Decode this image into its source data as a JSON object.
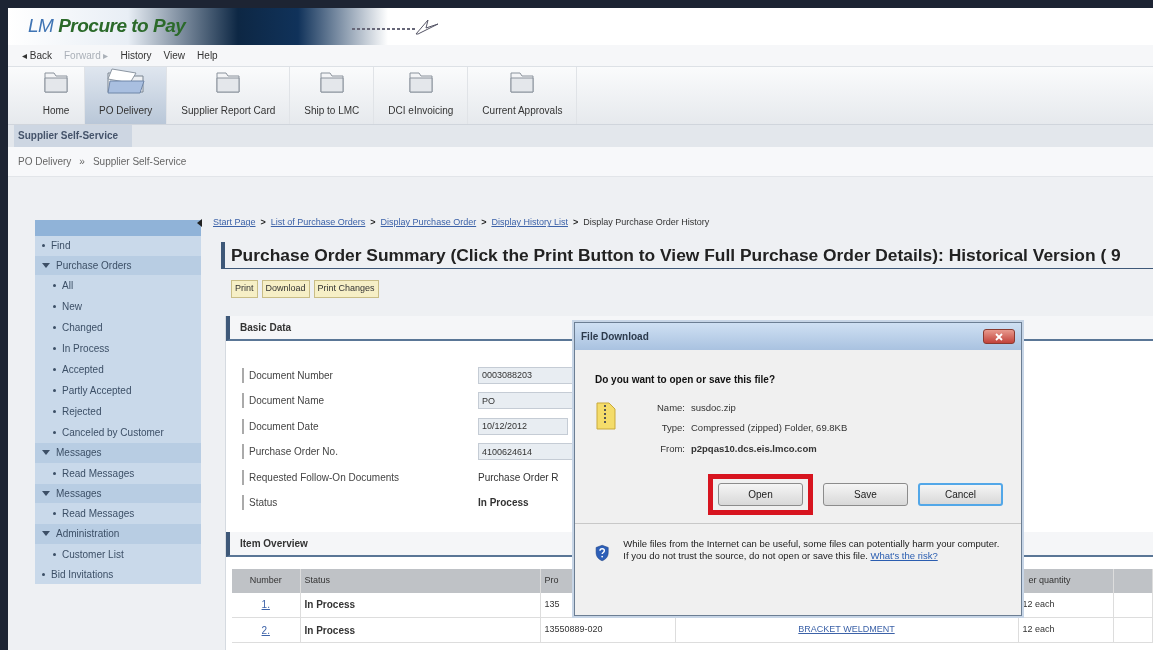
{
  "app": {
    "logo": "LM **Procure to Pay**"
  },
  "menu": [
    {
      "label": "◂ Back",
      "disabled": false
    },
    {
      "label": "Forward ▸",
      "disabled": true
    },
    {
      "label": "History",
      "disabled": false
    },
    {
      "label": "View",
      "disabled": false
    },
    {
      "label": "Help",
      "disabled": false
    }
  ],
  "toolbar": [
    {
      "label": "Home",
      "selected": false
    },
    {
      "label": "PO Delivery",
      "selected": true
    },
    {
      "label": "Supplier Report Card",
      "selected": false
    },
    {
      "label": "Ship to LMC",
      "selected": false
    },
    {
      "label": "DCI eInvoicing",
      "selected": false
    },
    {
      "label": "Current Approvals",
      "selected": false
    }
  ],
  "tabs": [
    {
      "label": "Supplier Self-Service",
      "selected": true
    }
  ],
  "location": [
    {
      "label": "PO Delivery"
    },
    {
      "separator": "»",
      "label": "Supplier Self-Service"
    }
  ],
  "sidebar": {
    "items": [
      {
        "label": "Find"
      },
      {
        "label": "Purchase Orders",
        "expanded": true,
        "children": [
          {
            "label": "All"
          },
          {
            "label": "New"
          },
          {
            "label": "Changed"
          },
          {
            "label": "In Process"
          },
          {
            "label": "Accepted"
          },
          {
            "label": "Partly Accepted"
          },
          {
            "label": "Rejected"
          },
          {
            "label": "Canceled by Customer"
          }
        ]
      },
      {
        "label": "Messages",
        "expanded": true,
        "children": [
          {
            "label": "Read Messages"
          }
        ]
      },
      {
        "label": "Messages",
        "expanded": true,
        "children": [
          {
            "label": "Read Messages"
          }
        ]
      },
      {
        "label": "Administration",
        "expanded": true,
        "children": [
          {
            "label": "Customer List"
          }
        ]
      },
      {
        "label": "Bid Invitations"
      }
    ]
  },
  "breadcrumb": [
    {
      "label": "Start Page",
      "link": true
    },
    {
      "separator": ">",
      "label": "List of Purchase Orders",
      "link": true
    },
    {
      "separator": ">",
      "label": "Display Purchase Order",
      "link": true
    },
    {
      "separator": ">",
      "label": "Display History List",
      "link": true
    },
    {
      "separator": ">",
      "label": "Display Purchase Order History",
      "link": false
    }
  ],
  "title": "Purchase Order Summary (Click the Print Button to View Full Purchase Order Details): Historical Version ( 9",
  "actions": [
    "Print",
    "Download",
    "Print Changes"
  ],
  "basic_data": {
    "heading": "Basic Data",
    "fields": [
      {
        "label": "Document Number",
        "kind": "input",
        "value": "0003088203"
      },
      {
        "label": "Document Name",
        "kind": "input",
        "value": "PO"
      },
      {
        "label": "Document Date",
        "kind": "date",
        "value": "10/12/2012"
      },
      {
        "label": "Purchase Order No.",
        "kind": "input",
        "value": "4100624614"
      },
      {
        "label": "Requested Follow-On Documents",
        "kind": "text",
        "value": "Purchase Order R"
      },
      {
        "label": "Status",
        "kind": "strong",
        "value": "In Process"
      }
    ]
  },
  "item_overview": {
    "heading": "Item Overview",
    "columns": [
      "Number",
      "Status",
      "Pro",
      "er quantity"
    ],
    "rows": [
      {
        "number": "1.",
        "status": "In Process",
        "product": "135",
        "quantity": "12 each"
      },
      {
        "number": "2.",
        "status": "In Process",
        "product": "13550889-020",
        "description": "BRACKET WELDMENT",
        "quantity": "12 each"
      }
    ]
  },
  "dialog": {
    "title": "File Download",
    "question": "Do you want to open or save this file?",
    "details": [
      {
        "label": "Name:",
        "value": "susdoc.zip",
        "bold": false
      },
      {
        "label": "Type:",
        "value": "Compressed (zipped) Folder, 69.8KB",
        "bold": false
      },
      {
        "label": "From:",
        "value": "p2pqas10.dcs.eis.lmco.com",
        "bold": true
      }
    ],
    "buttons": [
      {
        "label": "Open",
        "highlighted": true,
        "focused": false
      },
      {
        "label": "Save",
        "highlighted": false,
        "focused": false
      },
      {
        "label": "Cancel",
        "highlighted": false,
        "focused": true
      }
    ],
    "warning": "While files from the Internet can be useful, some files can potentially harm your computer. If you do not trust the source, do not open or save this file.",
    "warning_link": "What's the risk?"
  }
}
